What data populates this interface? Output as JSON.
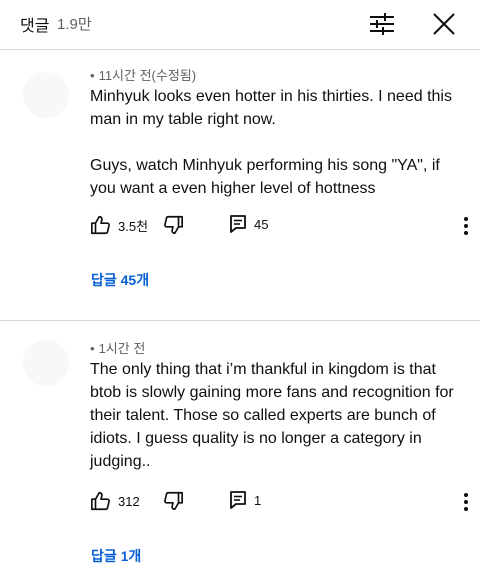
{
  "header": {
    "title": "댓글",
    "count": "1.9만"
  },
  "comments": [
    {
      "meta": "11시간 전(수정됨)",
      "paragraphs": [
        "Minhyuk looks even hotter in his thirties. I need this man in my table right now.",
        "Guys, watch Minhyuk performing his song \"YA\", if you want a even higher level of hottness"
      ],
      "likes": "3.5천",
      "reply_count": "45",
      "replies_label": "답글 45개"
    },
    {
      "meta": "1시간 전",
      "paragraphs": [
        "The only thing that i’m thankful in kingdom is that btob is slowly gaining more fans and recognition for their talent. Those so called experts are bunch of idiots. I guess quality is no longer a category in judging.."
      ],
      "likes": "312",
      "reply_count": "1",
      "replies_label": "답글 1개"
    }
  ],
  "icons": {
    "filter": "filter-sliders-icon",
    "close": "close-icon",
    "like": "thumbs-up-icon",
    "dislike": "thumbs-down-icon",
    "reply": "comment-icon",
    "more": "more-vertical-icon"
  },
  "colors": {
    "link": "#065fd4",
    "secondary_text": "#606060",
    "divider": "#d9d9d9"
  }
}
